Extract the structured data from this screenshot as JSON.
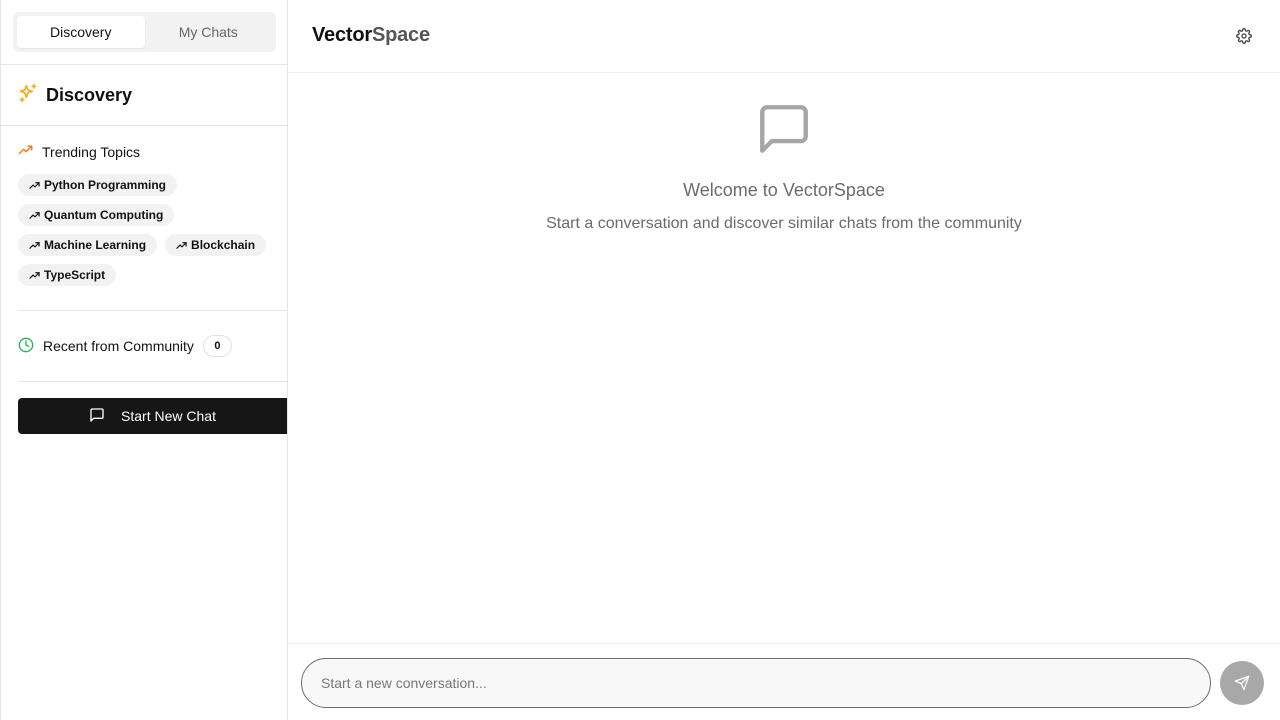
{
  "sidebar": {
    "tabs": [
      {
        "label": "Discovery",
        "active": true
      },
      {
        "label": "My Chats",
        "active": false
      }
    ],
    "discovery_title": "Discovery",
    "trending": {
      "title": "Trending Topics",
      "topics": [
        "Python Programming",
        "Quantum Computing",
        "Machine Learning",
        "Blockchain",
        "TypeScript"
      ]
    },
    "recent": {
      "title": "Recent from Community",
      "count": "0"
    },
    "new_chat_label": "Start New Chat"
  },
  "header": {
    "brand_part1": "Vector",
    "brand_part2": "Space"
  },
  "empty_state": {
    "title": "Welcome to VectorSpace",
    "subtitle": "Start a conversation and discover similar chats from the community"
  },
  "composer": {
    "placeholder": "Start a new conversation...",
    "value": ""
  },
  "colors": {
    "accent_sparkle": "#f2b01e",
    "trending_icon": "#f07a1a",
    "recent_icon": "#22b45a",
    "primary_button": "#161616",
    "send_button": "#a8a8a8"
  }
}
